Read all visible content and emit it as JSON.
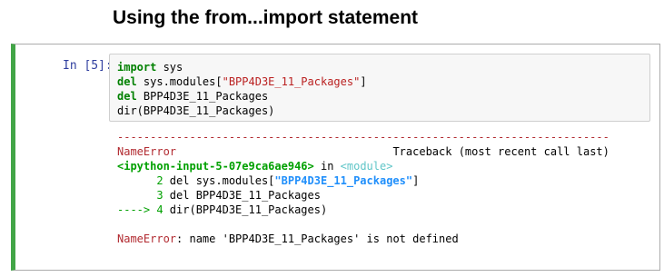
{
  "heading": "Using the from...import statement",
  "cell": {
    "prompt": "In [5]:",
    "code": {
      "line1_kw": "import",
      "line1_rest": " sys",
      "line2_kw": "del",
      "line2_a": " sys.modules[",
      "line2_str": "\"BPP4D3E_11_Packages\"",
      "line2_b": "]",
      "line3_kw": "del",
      "line3_rest": " BPP4D3E_11_Packages",
      "line4": "dir(BPP4D3E_11_Packages)"
    },
    "output": {
      "separator": "---------------------------------------------------------------------------",
      "error_name": "NameError",
      "traceback_label": "Traceback (most recent call last)",
      "input_ref": "<ipython-input-5-07e9ca6ae946>",
      "in_text": " in ",
      "module_ref": "<module>",
      "t2_num": "      2 ",
      "t2_a": "del sys.modules[",
      "t2_str": "\"BPP4D3E_11_Packages\"",
      "t2_b": "]",
      "t3_num": "      3 ",
      "t3_text": "del BPP4D3E_11_Packages",
      "t4_arrow": "----> 4 ",
      "t4_text": "dir(BPP4D3E_11_Packages)",
      "final_error_name": "NameError",
      "final_message": ": name 'BPP4D3E_11_Packages' is not defined"
    }
  }
}
